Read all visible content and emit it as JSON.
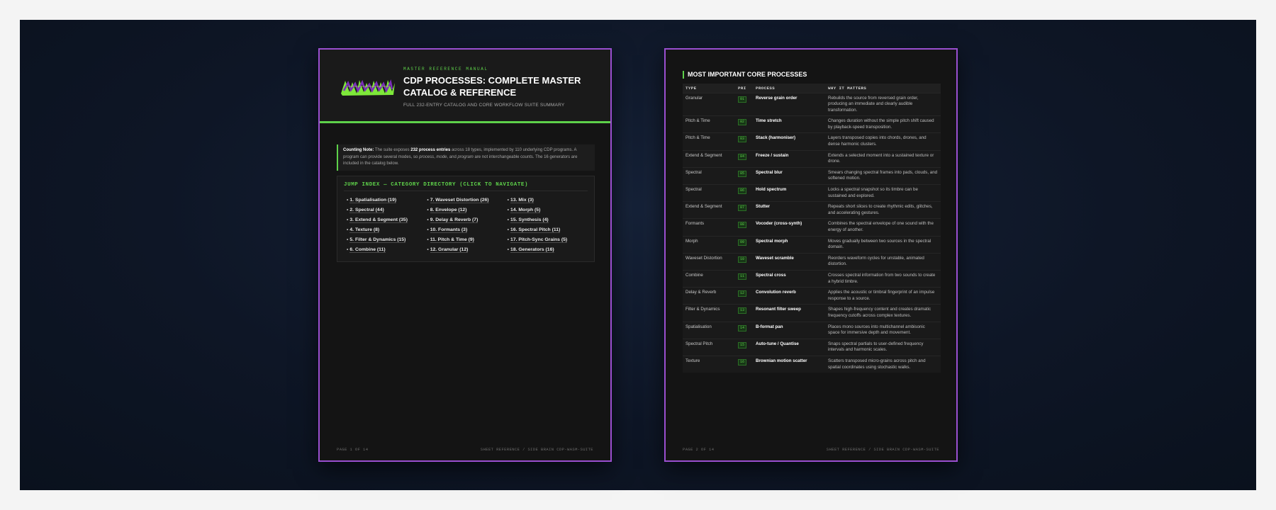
{
  "page1": {
    "header": {
      "kicker": "MASTER REFERENCE MANUAL",
      "title": "CDP PROCESSES: COMPLETE MASTER CATALOG & REFERENCE",
      "subtitle": "FULL 232-ENTRY CATALOG AND CORE WORKFLOW SUITE SUMMARY"
    },
    "note": {
      "label": "Counting Note:",
      "t1": " The suite exposes ",
      "b1": "232 process entries",
      "t2": " across 18 types, implemented by 110 underlying CDP programs. A program can provide several modes, so ",
      "i1": "process",
      "t3": ", ",
      "i2": "mode",
      "t4": ", and ",
      "i3": "program",
      "t5": " are not interchangeable counts. The 16 generators are included in the catalog below."
    },
    "jump": {
      "title": "JUMP INDEX — CATEGORY DIRECTORY (CLICK TO NAVIGATE)",
      "columns": [
        [
          "1. Spatialisation (19)",
          "2. Spectral (44)",
          "3. Extend & Segment (35)",
          "4. Texture (8)",
          "5. Filter & Dynamics (15)",
          "6. Combine (11)"
        ],
        [
          "7. Waveset Distortion (26)",
          "8. Envelope (12)",
          "9. Delay & Reverb (7)",
          "10. Formants (3)",
          "11. Pitch & Time (9)",
          "12. Granular (12)"
        ],
        [
          "13. Mix (3)",
          "14. Morph (5)",
          "15. Synthesis (4)",
          "16. Spectral Pitch (11)",
          "17. Pitch-Sync Grains (5)",
          "18. Generators (16)"
        ]
      ]
    },
    "footer": {
      "left": "PAGE 1 OF 14",
      "right": "SHEET REFERENCE / SIDE BRAIN CDP-WASM-SUITE"
    }
  },
  "page2": {
    "section_title": "MOST IMPORTANT CORE PROCESSES",
    "table": {
      "headers": [
        "TYPE",
        "PRI",
        "PROCESS",
        "WHY IT MATTERS"
      ],
      "rows": [
        {
          "type": "Granular",
          "pri": "01",
          "process": "Reverse grain order",
          "why": "Rebuilds the source from reversed grain order, producing an immediate and clearly audible transformation."
        },
        {
          "type": "Pitch & Time",
          "pri": "02",
          "process": "Time stretch",
          "why": "Changes duration without the simple pitch shift caused by playback-speed transposition."
        },
        {
          "type": "Pitch & Time",
          "pri": "03",
          "process": "Stack (harmoniser)",
          "why": "Layers transposed copies into chords, drones, and dense harmonic clusters."
        },
        {
          "type": "Extend & Segment",
          "pri": "04",
          "process": "Freeze / sustain",
          "why": "Extends a selected moment into a sustained texture or drone."
        },
        {
          "type": "Spectral",
          "pri": "05",
          "process": "Spectral blur",
          "why": "Smears changing spectral frames into pads, clouds, and softened motion."
        },
        {
          "type": "Spectral",
          "pri": "06",
          "process": "Hold spectrum",
          "why": "Locks a spectral snapshot so its timbre can be sustained and explored."
        },
        {
          "type": "Extend & Segment",
          "pri": "07",
          "process": "Stutter",
          "why": "Repeats short slices to create rhythmic edits, glitches, and accelerating gestures."
        },
        {
          "type": "Formants",
          "pri": "08",
          "process": "Vocoder (cross-synth)",
          "why": "Combines the spectral envelope of one sound with the energy of another."
        },
        {
          "type": "Morph",
          "pri": "09",
          "process": "Spectral morph",
          "why": "Moves gradually between two sources in the spectral domain."
        },
        {
          "type": "Waveset Distortion",
          "pri": "10",
          "process": "Waveset scramble",
          "why": "Reorders waveform cycles for unstable, animated distortion."
        },
        {
          "type": "Combine",
          "pri": "11",
          "process": "Spectral cross",
          "why": "Crosses spectral information from two sounds to create a hybrid timbre."
        },
        {
          "type": "Delay & Reverb",
          "pri": "12",
          "process": "Convolution reverb",
          "why": "Applies the acoustic or timbral fingerprint of an impulse response to a source."
        },
        {
          "type": "Filter & Dynamics",
          "pri": "13",
          "process": "Resonant filter sweep",
          "why": "Shapes high-frequency content and creates dramatic frequency cutoffs across complex textures."
        },
        {
          "type": "Spatialisation",
          "pri": "14",
          "process": "B-format pan",
          "why": "Places mono sources into multichannel ambisonic space for immersive depth and movement."
        },
        {
          "type": "Spectral Pitch",
          "pri": "15",
          "process": "Auto-tune / Quantise",
          "why": "Snaps spectral partials to user-defined frequency intervals and harmonic scales."
        },
        {
          "type": "Texture",
          "pri": "16",
          "process": "Brownian motion scatter",
          "why": "Scatters transposed micro-grains across pitch and spatial coordinates using stochastic walks."
        }
      ]
    },
    "footer": {
      "left": "PAGE 2 OF 14",
      "right": "SHEET REFERENCE / SIDE BRAIN CDP-WASM-SUITE"
    }
  },
  "colors": {
    "accent_green": "#5ed14a",
    "frame_purple": "#9a4fd0",
    "sheet_bg": "#141414",
    "stage_bg": "#0e1626"
  },
  "icons": {
    "logo": "graffiti-logo-icon"
  }
}
